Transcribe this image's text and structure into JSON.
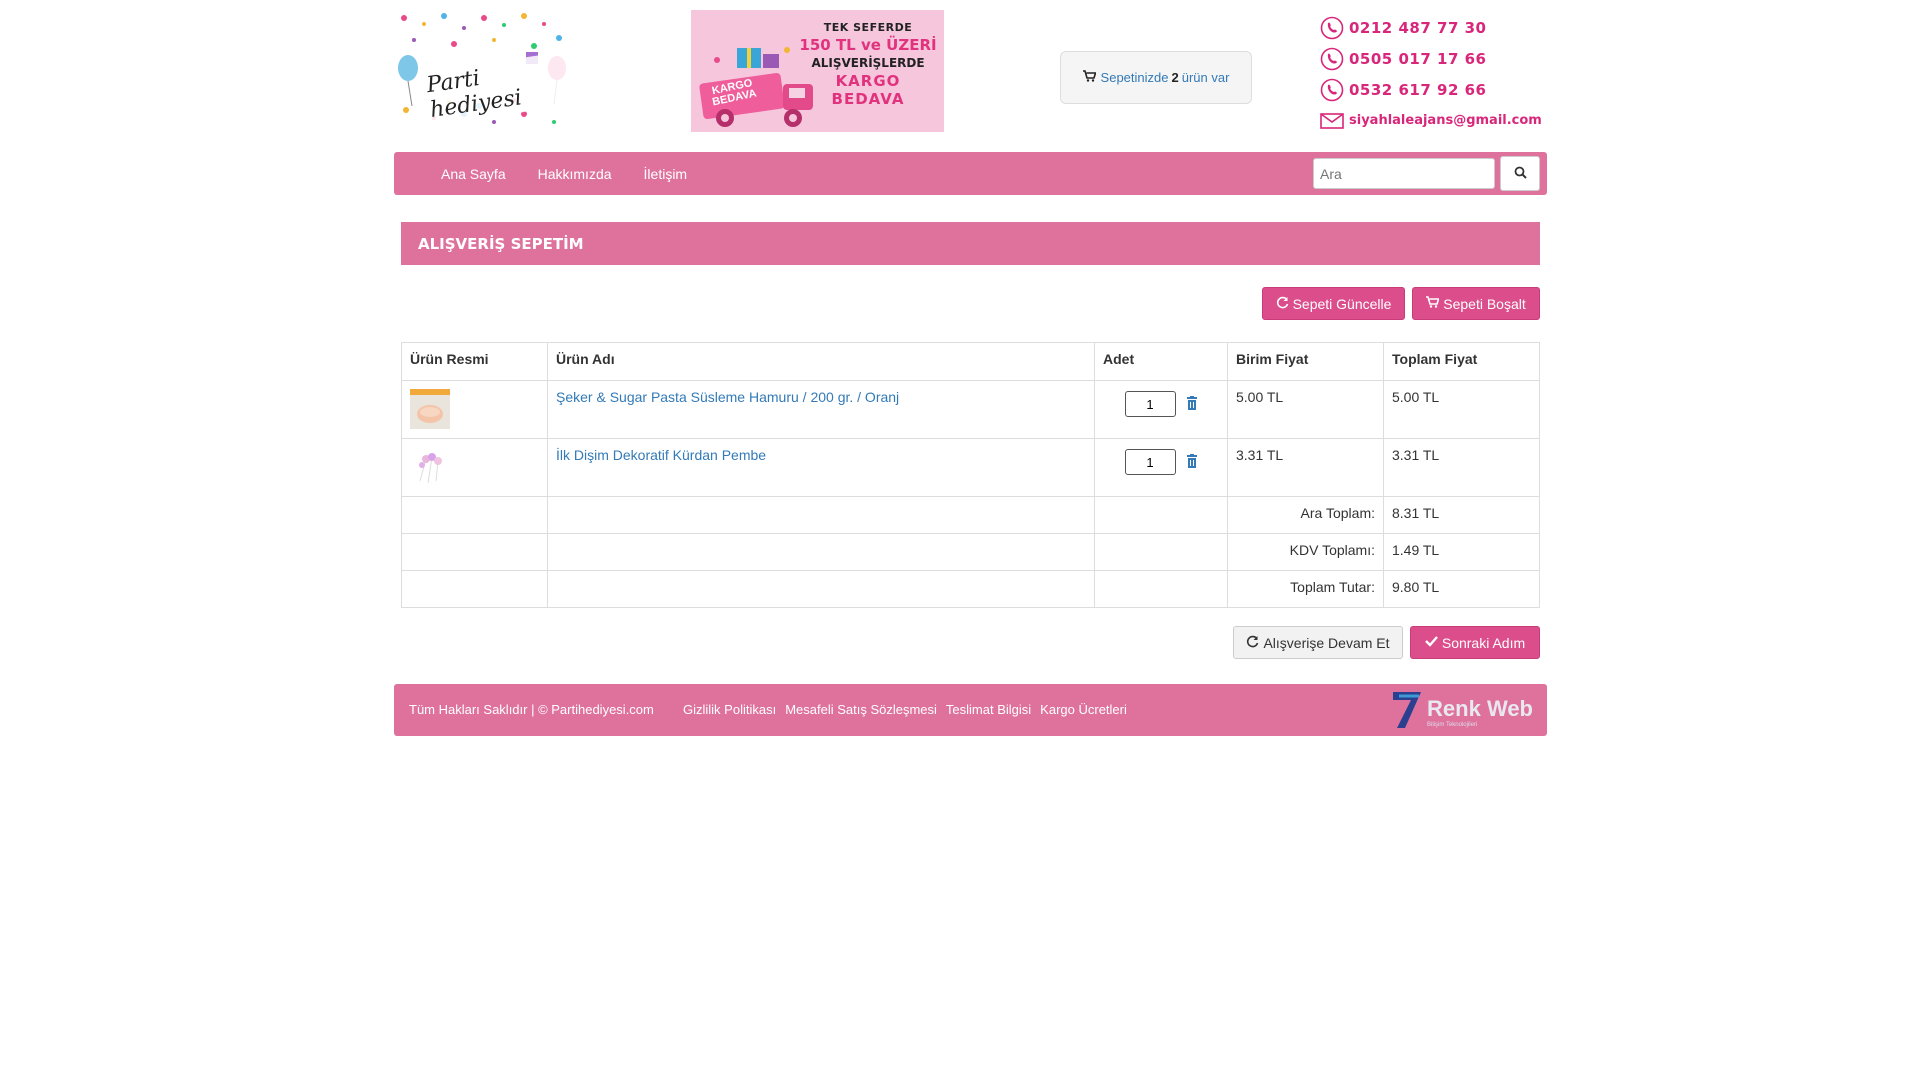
{
  "header": {
    "logo_text": "Parti hediyesi",
    "banner": {
      "line1": "TEK SEFERDE",
      "line2": "150 TL ve ÜZERİ",
      "line3": "ALIŞVERİŞLERDE",
      "line4": "KARGO",
      "line5": "BEDAVA",
      "truck_line1": "KARGO",
      "truck_line2": "BEDAVA"
    },
    "cart_summary": {
      "prefix": "Sepetinizde",
      "count": "2",
      "suffix": "ürün var"
    },
    "contacts": {
      "phone1": "0212 487 77 30",
      "phone2": "0505 017 17 66",
      "phone3": "0532 617 92 66",
      "email": "siyahlaleajans@gmail.com"
    }
  },
  "nav": {
    "items": [
      "Ana Sayfa",
      "Hakkımızda",
      "İletişim"
    ],
    "search_placeholder": "Ara"
  },
  "page": {
    "title": "ALIŞVERİŞ SEPETİM",
    "update_cart": "Sepeti Güncelle",
    "empty_cart": "Sepeti Boşalt",
    "continue_shopping": "Alışverişe Devam Et",
    "next_step": "Sonraki Adım"
  },
  "table": {
    "headers": [
      "Ürün Resmi",
      "Ürün Adı",
      "Adet",
      "Birim Fiyat",
      "Toplam Fiyat"
    ],
    "items": [
      {
        "name": "Şeker & Sugar Pasta Süsleme Hamuru / 200 gr. / Oranj",
        "qty": "1",
        "unit_price": "5.00 TL",
        "total": "5.00 TL"
      },
      {
        "name": "İlk Dişim Dekoratif Kürdan Pembe",
        "qty": "1",
        "unit_price": "3.31 TL",
        "total": "3.31 TL"
      }
    ],
    "summary": [
      {
        "label": "Ara Toplam:",
        "value": "8.31 TL"
      },
      {
        "label": "KDV Toplamı:",
        "value": "1.49 TL"
      },
      {
        "label": "Toplam Tutar:",
        "value": "9.80 TL"
      }
    ]
  },
  "footer": {
    "copyright": "Tüm Hakları Saklıdır | © Partihediyesi.com",
    "links": [
      "Gizlilik Politikası",
      "Mesafeli Satış Sözleşmesi",
      "Teslimat Bilgisi",
      "Kargo Ücretleri"
    ],
    "brand": "Renk Web",
    "brand_sub": "Bilişim Teknolojileri"
  },
  "colors": {
    "accent": "#df729c",
    "button": "#db4d8b",
    "link": "#337ab7",
    "contact": "#d8267a"
  }
}
